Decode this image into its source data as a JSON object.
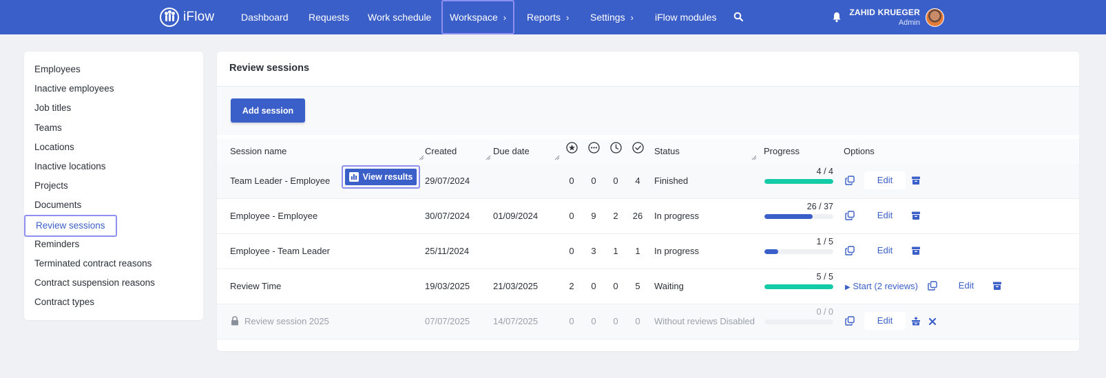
{
  "app": {
    "name": "iFlow"
  },
  "nav": {
    "items": [
      {
        "label": "Dashboard"
      },
      {
        "label": "Requests"
      },
      {
        "label": "Work schedule"
      },
      {
        "label": "Workspace",
        "active": true
      },
      {
        "label": "Reports"
      },
      {
        "label": "Settings"
      },
      {
        "label": "iFlow modules"
      }
    ]
  },
  "user": {
    "name": "ZAHID KRUEGER",
    "role": "Admin"
  },
  "sidebar": {
    "items": [
      {
        "label": "Employees"
      },
      {
        "label": "Inactive employees"
      },
      {
        "label": "Job titles"
      },
      {
        "label": "Teams"
      },
      {
        "label": "Locations"
      },
      {
        "label": "Inactive locations"
      },
      {
        "label": "Projects"
      },
      {
        "label": "Documents"
      },
      {
        "label": "Review sessions",
        "active": true
      },
      {
        "label": "Reminders"
      },
      {
        "label": "Terminated contract reasons"
      },
      {
        "label": "Contract suspension reasons"
      },
      {
        "label": "Contract types"
      }
    ]
  },
  "main": {
    "title": "Review sessions",
    "add_label": "Add session",
    "view_results_label": "View results",
    "columns": {
      "session_name": "Session name",
      "created": "Created",
      "due_date": "Due date",
      "status": "Status",
      "progress": "Progress",
      "options": "Options"
    },
    "stat_icons": [
      "star-icon",
      "dots-icon",
      "clock-icon",
      "check-icon"
    ],
    "edit_label": "Edit",
    "rows": [
      {
        "name": "Team Leader - Employee",
        "created": "29/07/2024",
        "due": "",
        "stats": [
          "0",
          "0",
          "0",
          "4"
        ],
        "status": "Finished",
        "progress_text": "4 / 4",
        "progress": 1.0,
        "progress_color": "#14cba8"
      },
      {
        "name": "Employee - Employee",
        "created": "30/07/2024",
        "due": "01/09/2024",
        "stats": [
          "0",
          "9",
          "2",
          "26"
        ],
        "status": "In progress",
        "progress_text": "26 / 37",
        "progress": 0.703,
        "progress_color": "#3b5fc8"
      },
      {
        "name": "Employee - Team Leader",
        "created": "25/11/2024",
        "due": "",
        "stats": [
          "0",
          "3",
          "1",
          "1"
        ],
        "status": "In progress",
        "progress_text": "1 / 5",
        "progress": 0.2,
        "progress_color": "#3b5fc8"
      },
      {
        "name": "Review Time",
        "created": "19/03/2025",
        "due": "21/03/2025",
        "stats": [
          "2",
          "0",
          "0",
          "5"
        ],
        "status": "Waiting",
        "progress_text": "5 / 5",
        "progress": 1.0,
        "progress_color": "#14cba8",
        "start_label": "Start",
        "start_count": "(2 reviews)"
      },
      {
        "name": "Review session 2025",
        "created": "07/07/2025",
        "due": "14/07/2025",
        "stats": [
          "0",
          "0",
          "0",
          "0"
        ],
        "status": "Without reviews Disabled",
        "progress_text": "0 / 0",
        "progress": 0,
        "progress_color": "#3b5fc8",
        "locked": true
      }
    ]
  }
}
